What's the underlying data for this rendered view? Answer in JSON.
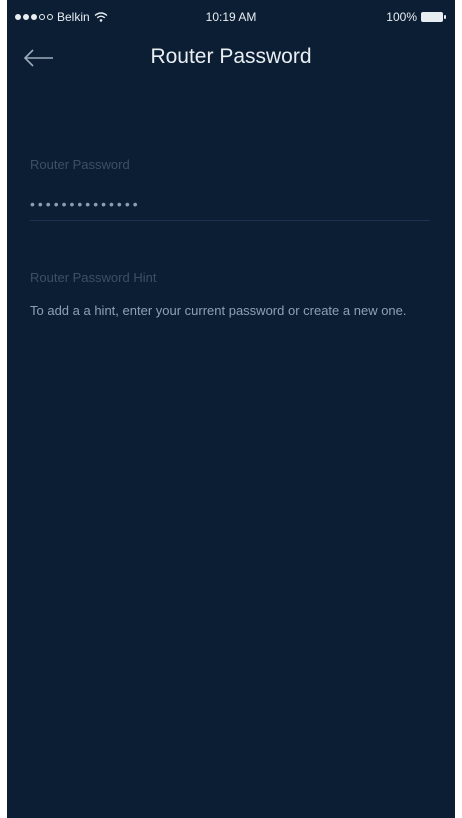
{
  "status_bar": {
    "carrier": "Belkin",
    "time": "10:19 AM",
    "battery": "100%"
  },
  "nav": {
    "title": "Router Password"
  },
  "password": {
    "label": "Router Password",
    "value": "••••••••••••••"
  },
  "hint": {
    "label": "Router Password Hint",
    "text": "To add a a hint, enter your current password or create a new one."
  },
  "colors": {
    "background": "#0c1e33",
    "title": "#e9eef3",
    "label": "#3a5068",
    "body_text": "#8ea0b3"
  }
}
